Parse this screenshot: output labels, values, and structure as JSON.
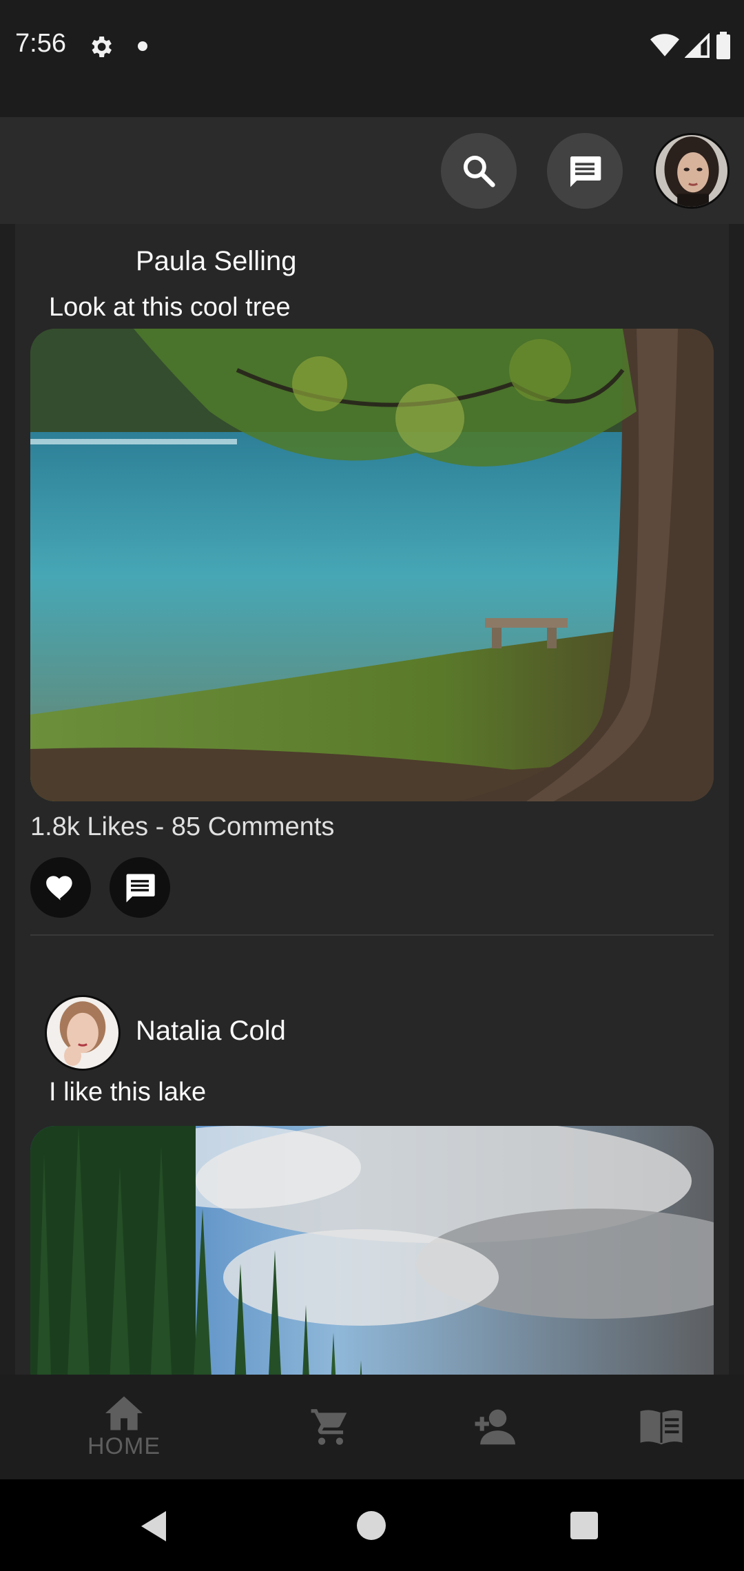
{
  "status_bar": {
    "time": "7:56",
    "icons": [
      "gear-icon",
      "dot-icon",
      "wifi-icon",
      "signal-icon",
      "battery-icon"
    ]
  },
  "app_bar": {
    "icons": [
      "search-icon",
      "chat-icon",
      "profile-avatar"
    ]
  },
  "posts": [
    {
      "author": "Paula Selling",
      "caption": "Look at this cool tree",
      "stats": "1.8k Likes - 85 Comments",
      "image": "lake-tree-photo"
    },
    {
      "author": "Natalia Cold",
      "caption": "I like this lake",
      "image": "forest-sky-photo"
    }
  ],
  "bottom_nav": {
    "items": [
      {
        "label": "HOME",
        "icon": "home-icon"
      },
      {
        "icon": "cart-icon"
      },
      {
        "icon": "add-person-icon"
      },
      {
        "icon": "book-icon"
      }
    ]
  },
  "colors": {
    "background": "#1f1f1f",
    "card": "#272727",
    "app_bar": "#2b2b2b",
    "nav_label": "#5e5e5e"
  }
}
